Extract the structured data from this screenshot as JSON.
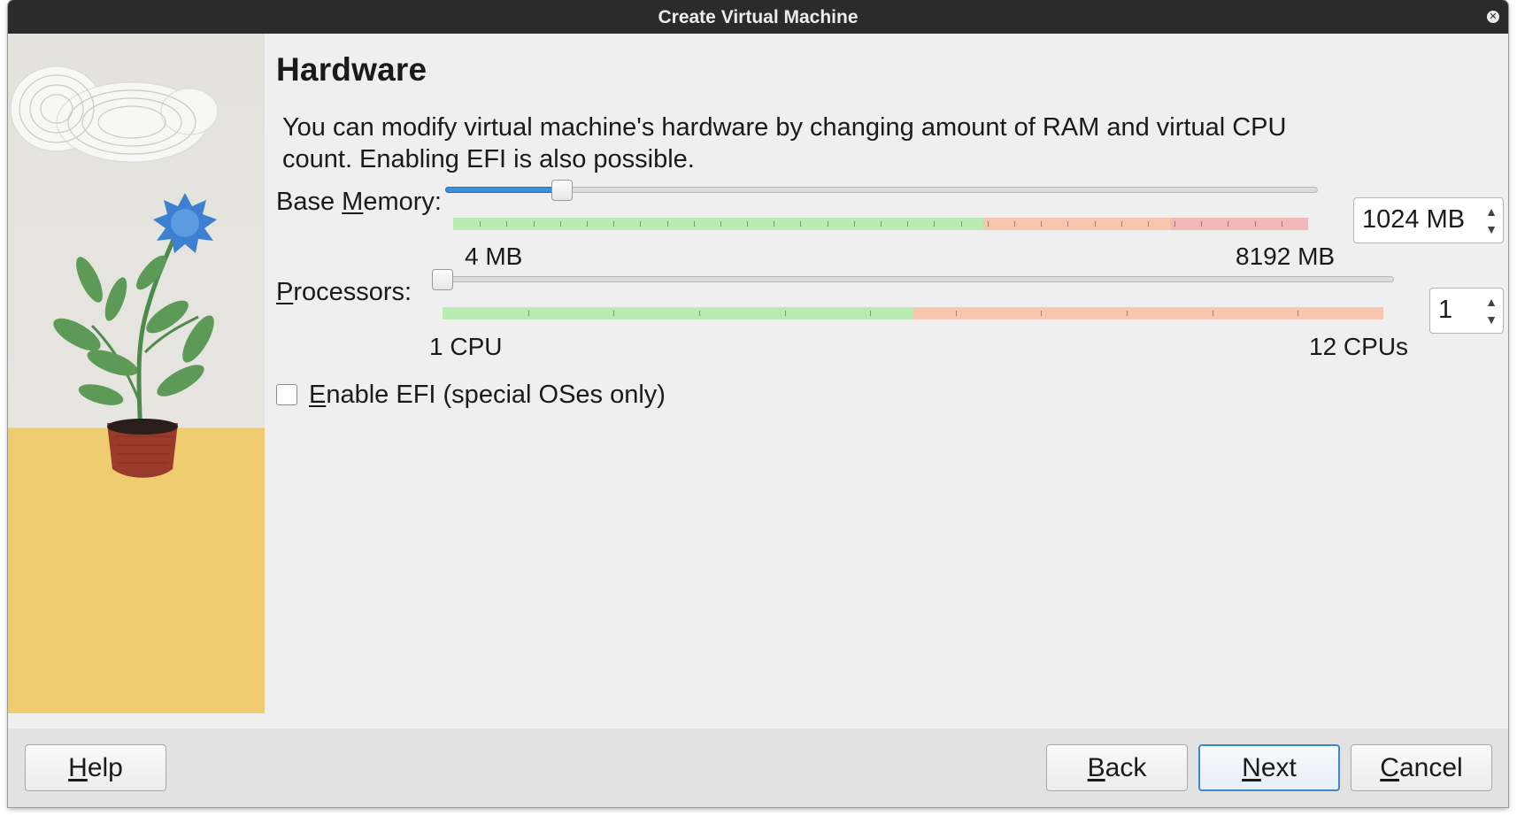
{
  "window": {
    "title": "Create Virtual Machine"
  },
  "page": {
    "heading": "Hardware",
    "description": "You can modify virtual machine's hardware by changing amount of RAM and virtual CPU count. Enabling EFI is also possible."
  },
  "memory": {
    "label": "Base Memory:",
    "mnemonic_pre": "Base ",
    "mnemonic_key": "M",
    "mnemonic_post": "emory:",
    "min_label": "4 MB",
    "max_label": "8192 MB",
    "value_text": "1024 MB",
    "value_mb": 1024,
    "min_mb": 4,
    "max_mb": 8192
  },
  "processors": {
    "label": "Processors:",
    "mnemonic_key": "P",
    "mnemonic_post": "rocessors:",
    "min_label": "1 CPU",
    "max_label": "12 CPUs",
    "value_text": "1",
    "value": 1,
    "min": 1,
    "max": 12
  },
  "efi": {
    "label": "Enable EFI (special OSes only)",
    "mnemonic_key": "E",
    "mnemonic_post": "nable EFI (special OSes only)",
    "checked": false
  },
  "buttons": {
    "help": {
      "label": "Help",
      "key": "H",
      "rest": "elp"
    },
    "back": {
      "label": "Back",
      "key": "B",
      "rest": "ack"
    },
    "next": {
      "label": "Next",
      "key": "N",
      "rest": "ext"
    },
    "cancel": {
      "label": "Cancel",
      "key": "C",
      "rest": "ancel"
    }
  },
  "icons": [
    "close-icon",
    "spin-up-icon",
    "spin-down-icon"
  ],
  "colors": {
    "accent": "#3c8fd6",
    "range_ok": "#b7edb1",
    "range_warn": "#f6c7ae",
    "range_danger": "#f2b7b7",
    "art_ground": "#f0cc70"
  }
}
